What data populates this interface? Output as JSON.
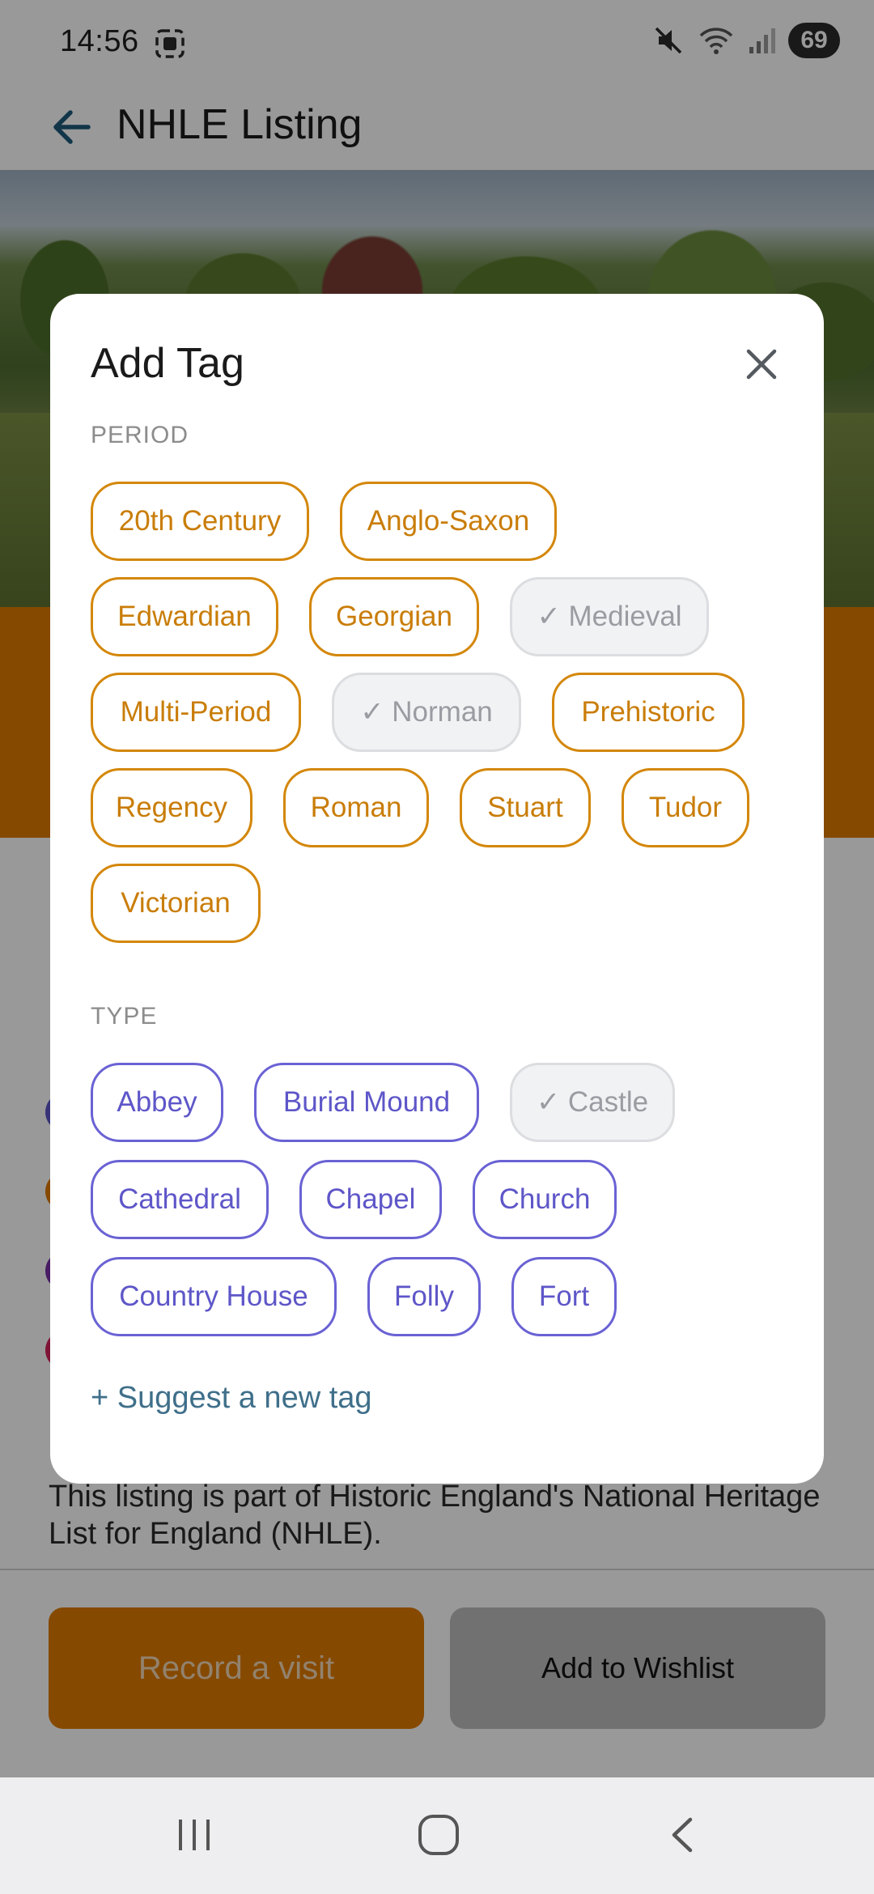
{
  "status_bar": {
    "time": "14:56",
    "battery": "69"
  },
  "app_bar": {
    "title": "NHLE Listing"
  },
  "page": {
    "nhle_note": "This listing is part of Historic England's National Heritage List for England (NHLE).",
    "record_button": "Record a visit",
    "wishlist_button": "Add to Wishlist"
  },
  "dialog": {
    "title": "Add Tag",
    "period_label": "PERIOD",
    "type_label": "TYPE",
    "suggest_link": "+ Suggest a new tag",
    "period_tags": [
      {
        "label": "20th Century",
        "selected": false
      },
      {
        "label": "Anglo-Saxon",
        "selected": false
      },
      {
        "label": "Edwardian",
        "selected": false
      },
      {
        "label": "Georgian",
        "selected": false
      },
      {
        "label": "✓ Medieval",
        "selected": true
      },
      {
        "label": "Multi-Period",
        "selected": false
      },
      {
        "label": "✓ Norman",
        "selected": true
      },
      {
        "label": "Prehistoric",
        "selected": false
      },
      {
        "label": "Regency",
        "selected": false
      },
      {
        "label": "Roman",
        "selected": false
      },
      {
        "label": "Stuart",
        "selected": false
      },
      {
        "label": "Tudor",
        "selected": false
      },
      {
        "label": "Victorian",
        "selected": false
      }
    ],
    "type_tags": [
      {
        "label": "Abbey",
        "selected": false
      },
      {
        "label": "Burial Mound",
        "selected": false
      },
      {
        "label": "✓ Castle",
        "selected": true
      },
      {
        "label": "Cathedral",
        "selected": false
      },
      {
        "label": "Chapel",
        "selected": false
      },
      {
        "label": "Church",
        "selected": false
      },
      {
        "label": "Country House",
        "selected": false
      },
      {
        "label": "Folly",
        "selected": false
      },
      {
        "label": "Fort",
        "selected": false
      }
    ]
  },
  "colors": {
    "accent_orange": "#e07a00",
    "period_chip": "#d4870a",
    "type_chip": "#6a62d4",
    "selected_chip_bg": "#f1f2f4",
    "link": "#3f6f8a"
  }
}
